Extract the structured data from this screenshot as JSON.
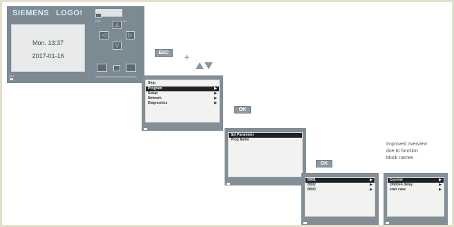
{
  "device": {
    "brand": "SIEMENS",
    "model": "LOGO!",
    "date_time_line": "Mon. 13:37",
    "date_line": "2017-01-16"
  },
  "keys": {
    "esc": "ESC",
    "plus": "+",
    "ok1": "OK",
    "ok2": "OK"
  },
  "screen_main_menu": {
    "title": "Stop",
    "items": [
      {
        "label": "Program",
        "selected": true
      },
      {
        "label": "Setup",
        "selected": false
      },
      {
        "label": "Network",
        "selected": false
      },
      {
        "label": "Diagnostics",
        "selected": false
      }
    ]
  },
  "screen_program": {
    "items": [
      {
        "label": "Set Parameter",
        "selected": true
      },
      {
        "label": "Prog Name",
        "selected": false
      }
    ]
  },
  "screen_blocks": {
    "items": [
      {
        "label": "B001",
        "selected": true
      },
      {
        "label": "B002",
        "selected": false
      },
      {
        "label": "B003",
        "selected": false
      }
    ]
  },
  "screen_block_names": {
    "items": [
      {
        "label": "Counter",
        "selected": true
      },
      {
        "label": "ON/OFF delay",
        "selected": false
      },
      {
        "label": "stair case",
        "selected": false
      }
    ]
  },
  "note": {
    "lines": [
      "Improved overview",
      "due to function",
      "block names"
    ]
  },
  "colors": {
    "device_body": "#7b8a93",
    "lcd_frame": "#838e96",
    "selection": "#1e2226",
    "key_bg": "#8d9aa3",
    "arrow_keys": "#8a97a0"
  }
}
